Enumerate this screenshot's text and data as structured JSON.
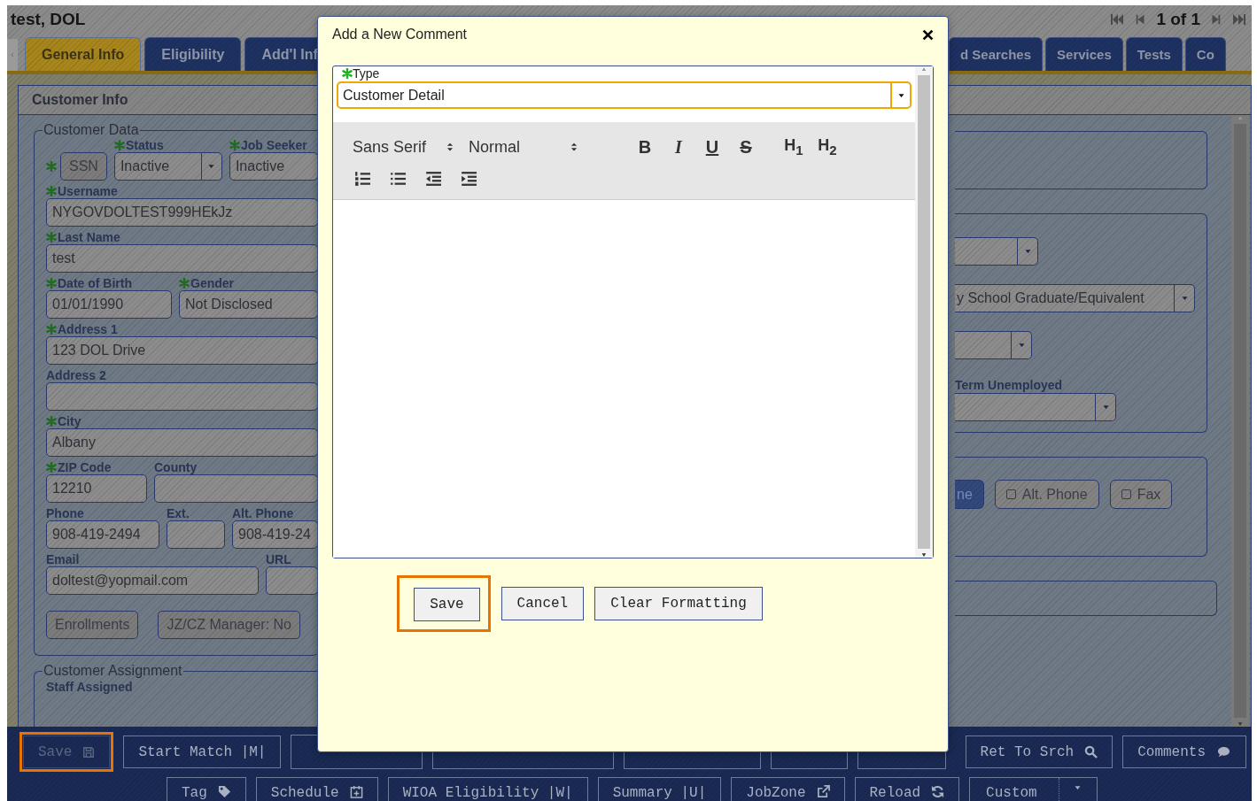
{
  "header": {
    "name": "test, DOL",
    "pager": "1 of 1"
  },
  "tabs": {
    "left": [
      {
        "label": "General Info",
        "selected": true
      },
      {
        "label": "Eligibility",
        "selected": false
      },
      {
        "label": "Add'l Inf",
        "selected": false
      }
    ],
    "right": [
      {
        "label": "d Searches",
        "selected": false
      },
      {
        "label": "Services",
        "selected": false
      },
      {
        "label": "Tests",
        "selected": false
      },
      {
        "label": "Co",
        "selected": false
      }
    ]
  },
  "section_title": "Customer Info",
  "customer_data": {
    "legend": "Customer Data",
    "rows": [
      [
        {
          "kind": "button",
          "label": "SSN",
          "required": true
        },
        {
          "kind": "select",
          "label": "Status",
          "required": true,
          "value": "Inactive"
        },
        {
          "kind": "text",
          "label": "Job Seeker",
          "required": true,
          "value": "Inactive"
        }
      ],
      [
        {
          "kind": "text",
          "label": "Username",
          "required": true,
          "value": "NYGOVDOLTEST999HEkJz"
        }
      ],
      [
        {
          "kind": "text",
          "label": "Last Name",
          "required": true,
          "value": "test"
        }
      ],
      [
        {
          "kind": "text",
          "label": "Date of Birth",
          "required": true,
          "value": "01/01/1990"
        },
        {
          "kind": "text",
          "label": "Gender",
          "required": true,
          "value": "Not Disclosed"
        }
      ],
      [
        {
          "kind": "text",
          "label": "Address 1",
          "required": true,
          "value": "123 DOL Drive"
        }
      ],
      [
        {
          "kind": "text",
          "label": "Address 2",
          "required": false
        }
      ],
      [
        {
          "kind": "text",
          "label": "City",
          "required": true,
          "value": "Albany"
        }
      ],
      [
        {
          "kind": "text",
          "label": "ZIP Code",
          "required": true,
          "value": "12210"
        },
        {
          "kind": "text",
          "label": "County",
          "required": false
        }
      ],
      [
        {
          "kind": "text",
          "label": "Phone",
          "required": false,
          "value": "908-419-2494"
        },
        {
          "kind": "text",
          "label": "Ext.",
          "required": false
        },
        {
          "kind": "text",
          "label": "Alt. Phone",
          "required": false,
          "value": "908-419-24"
        }
      ],
      [
        {
          "kind": "text",
          "label": "Email",
          "required": false,
          "value": "doltest@yopmail.com"
        },
        {
          "kind": "text",
          "label": "URL",
          "required": false
        }
      ],
      [
        {
          "kind": "button",
          "label": "Enrollments",
          "required": false
        },
        {
          "kind": "button",
          "label": "JZ/CZ Manager: No",
          "required": false
        }
      ]
    ]
  },
  "customer_assignment": {
    "legend": "Customer Assignment",
    "label": "Staff Assigned"
  },
  "right_selects": [
    {
      "kind": "select"
    },
    {
      "kind": "select",
      "value": "y School Graduate/Equivalent"
    },
    {
      "kind": "select"
    },
    {
      "kind": "select",
      "label": "Term Unemployed"
    }
  ],
  "contact_options": [
    {
      "label": "ne",
      "selected": true
    },
    {
      "label": "Alt. Phone",
      "selected": false
    },
    {
      "label": "Fax",
      "selected": false
    }
  ],
  "toolbar": {
    "row1": [
      {
        "label": "Save",
        "disabled": true,
        "highlighted": true
      },
      {
        "label": "Start Match |M|",
        "disabled": false,
        "highlighted": false
      },
      {
        "label": "Ret To Srch",
        "disabled": false,
        "highlighted": false
      },
      {
        "label": "Comments",
        "disabled": false,
        "highlighted": false
      }
    ],
    "row2": [
      {
        "kind": "button",
        "label": "Tag"
      },
      {
        "kind": "button",
        "label": "Schedule"
      },
      {
        "kind": "button",
        "label": "WIOA Eligibility |W|"
      },
      {
        "kind": "button",
        "label": "Summary |U|"
      },
      {
        "kind": "button",
        "label": "JobZone"
      },
      {
        "kind": "button",
        "label": "Reload"
      },
      {
        "kind": "split",
        "label": "Custom"
      }
    ]
  },
  "dialog": {
    "title": "Add a New Comment",
    "type_label": "Type",
    "type_required": true,
    "type_value": "Customer Detail",
    "font": "Sans Serif",
    "size": "Normal",
    "formats": [
      "B",
      "I",
      "U",
      "S",
      "H$_{1}$",
      "H$_{2}$"
    ],
    "buttons": [
      {
        "label": "Save",
        "highlighted": true
      },
      {
        "label": "Cancel",
        "highlighted": false
      },
      {
        "label": "Clear Formatting",
        "highlighted": false
      }
    ]
  }
}
